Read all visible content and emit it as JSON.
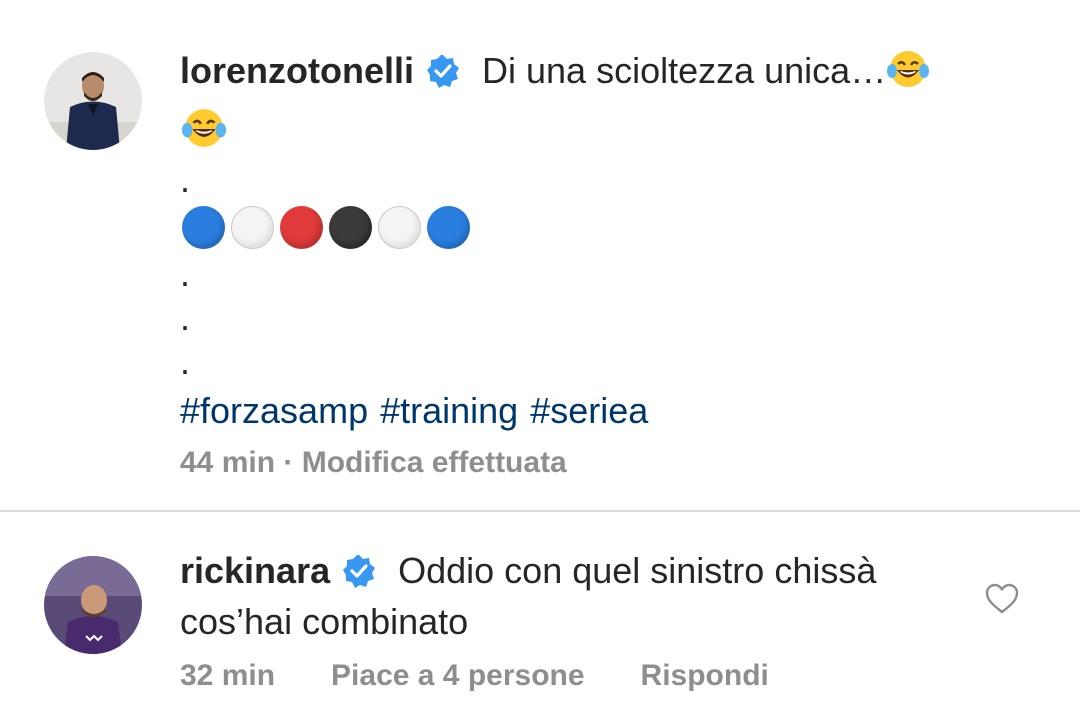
{
  "post": {
    "username": "lorenzotonelli",
    "caption": "Di una scioltezza unica…",
    "dot": ".",
    "color_circles": [
      "#2a7ee0",
      "#f2f2f2",
      "#e03a3a",
      "#3a3a3a",
      "#f2f2f2",
      "#2a7ee0"
    ],
    "hashtags": [
      "#forzasamp",
      "#training",
      "#seriea"
    ],
    "time": "44 min",
    "separator": " · ",
    "edited": "Modifica effettuata"
  },
  "comment": {
    "username": "rickinara",
    "text": "Oddio con quel sinistro chissà cos’hai combinato",
    "time": "32 min",
    "likes": "Piace a 4 persone",
    "reply": "Rispondi"
  },
  "colors": {
    "verified": "#3897f0",
    "hashtag": "#00376b",
    "meta": "#8e8e8e"
  }
}
